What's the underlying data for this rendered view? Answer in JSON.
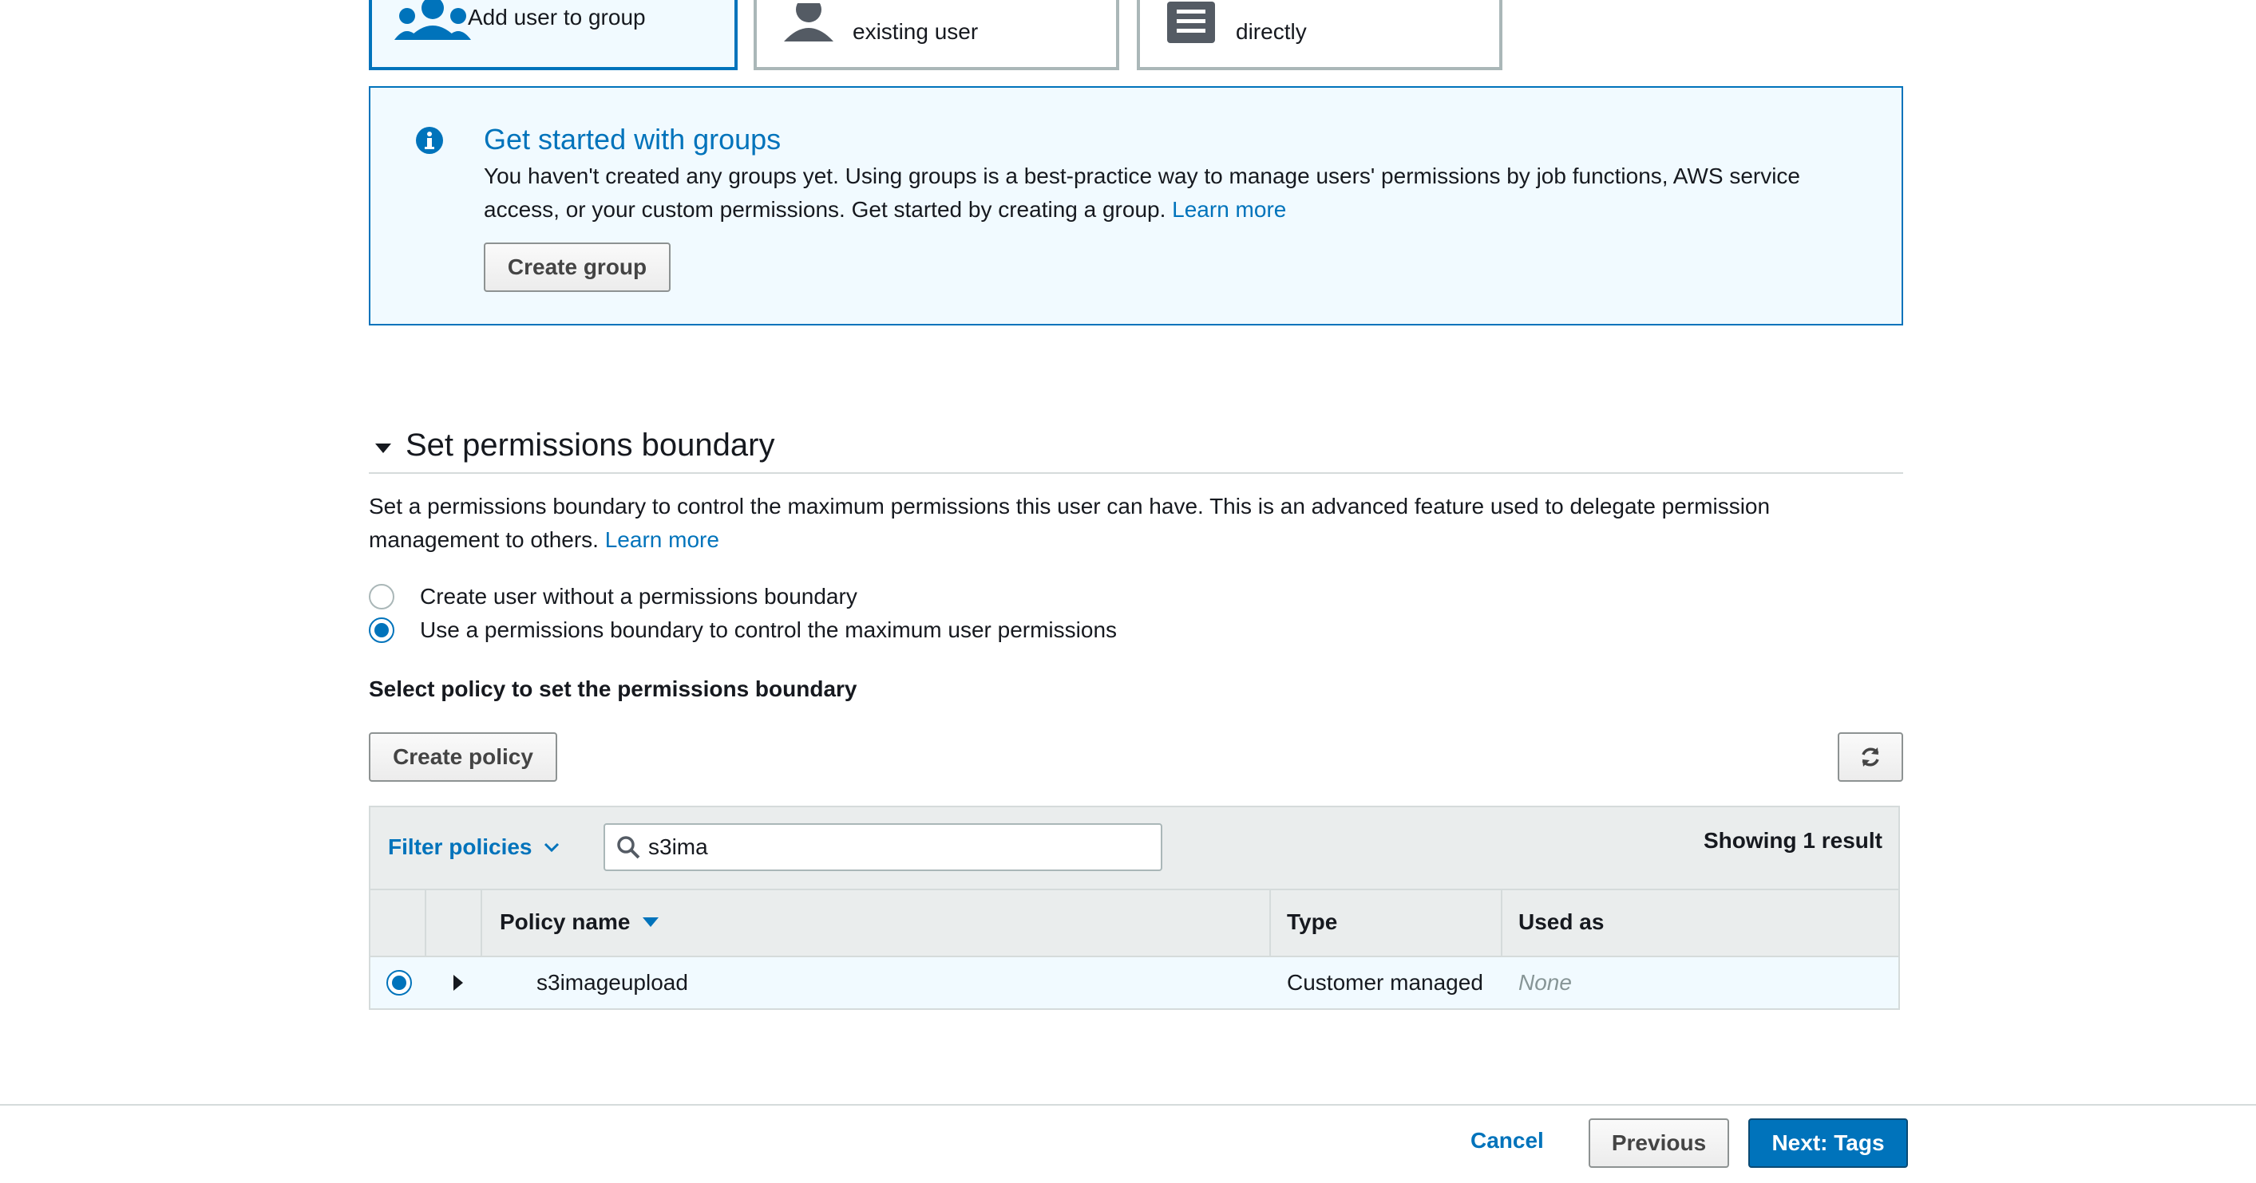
{
  "options": {
    "add_to_group": "Add user to group",
    "copy_existing": "existing user",
    "attach_directly": "directly"
  },
  "info": {
    "title": "Get started with groups",
    "body": "You haven't created any groups yet. Using groups is a best-practice way to manage users' permissions by job functions, AWS service access, or your custom permissions. Get started by creating a group.",
    "learn_more": "Learn more",
    "create_group": "Create group"
  },
  "boundary": {
    "title": "Set permissions boundary",
    "description": "Set a permissions boundary to control the maximum permissions this user can have. This is an advanced feature used to delegate permission management to others.",
    "learn_more": "Learn more",
    "radio_without": "Create user without a permissions boundary",
    "radio_use": "Use a permissions boundary to control the maximum user permissions",
    "select_heading": "Select policy to set the permissions boundary",
    "create_policy": "Create policy"
  },
  "table": {
    "filter_label": "Filter policies",
    "search_value": "s3ima",
    "showing": "Showing 1 result",
    "columns": [
      "Policy name",
      "Type",
      "Used as"
    ],
    "rows": [
      {
        "name": "s3imageupload",
        "type": "Customer managed",
        "used_as": "None",
        "selected": true
      }
    ]
  },
  "footer": {
    "cancel": "Cancel",
    "previous": "Previous",
    "next": "Next: Tags"
  },
  "colors": {
    "accent": "#0073bb",
    "info_bg": "#f1faff",
    "border": "#d5dbdb"
  },
  "icons": {
    "info": "info-circle-icon",
    "search": "search-icon",
    "refresh": "refresh-icon"
  }
}
